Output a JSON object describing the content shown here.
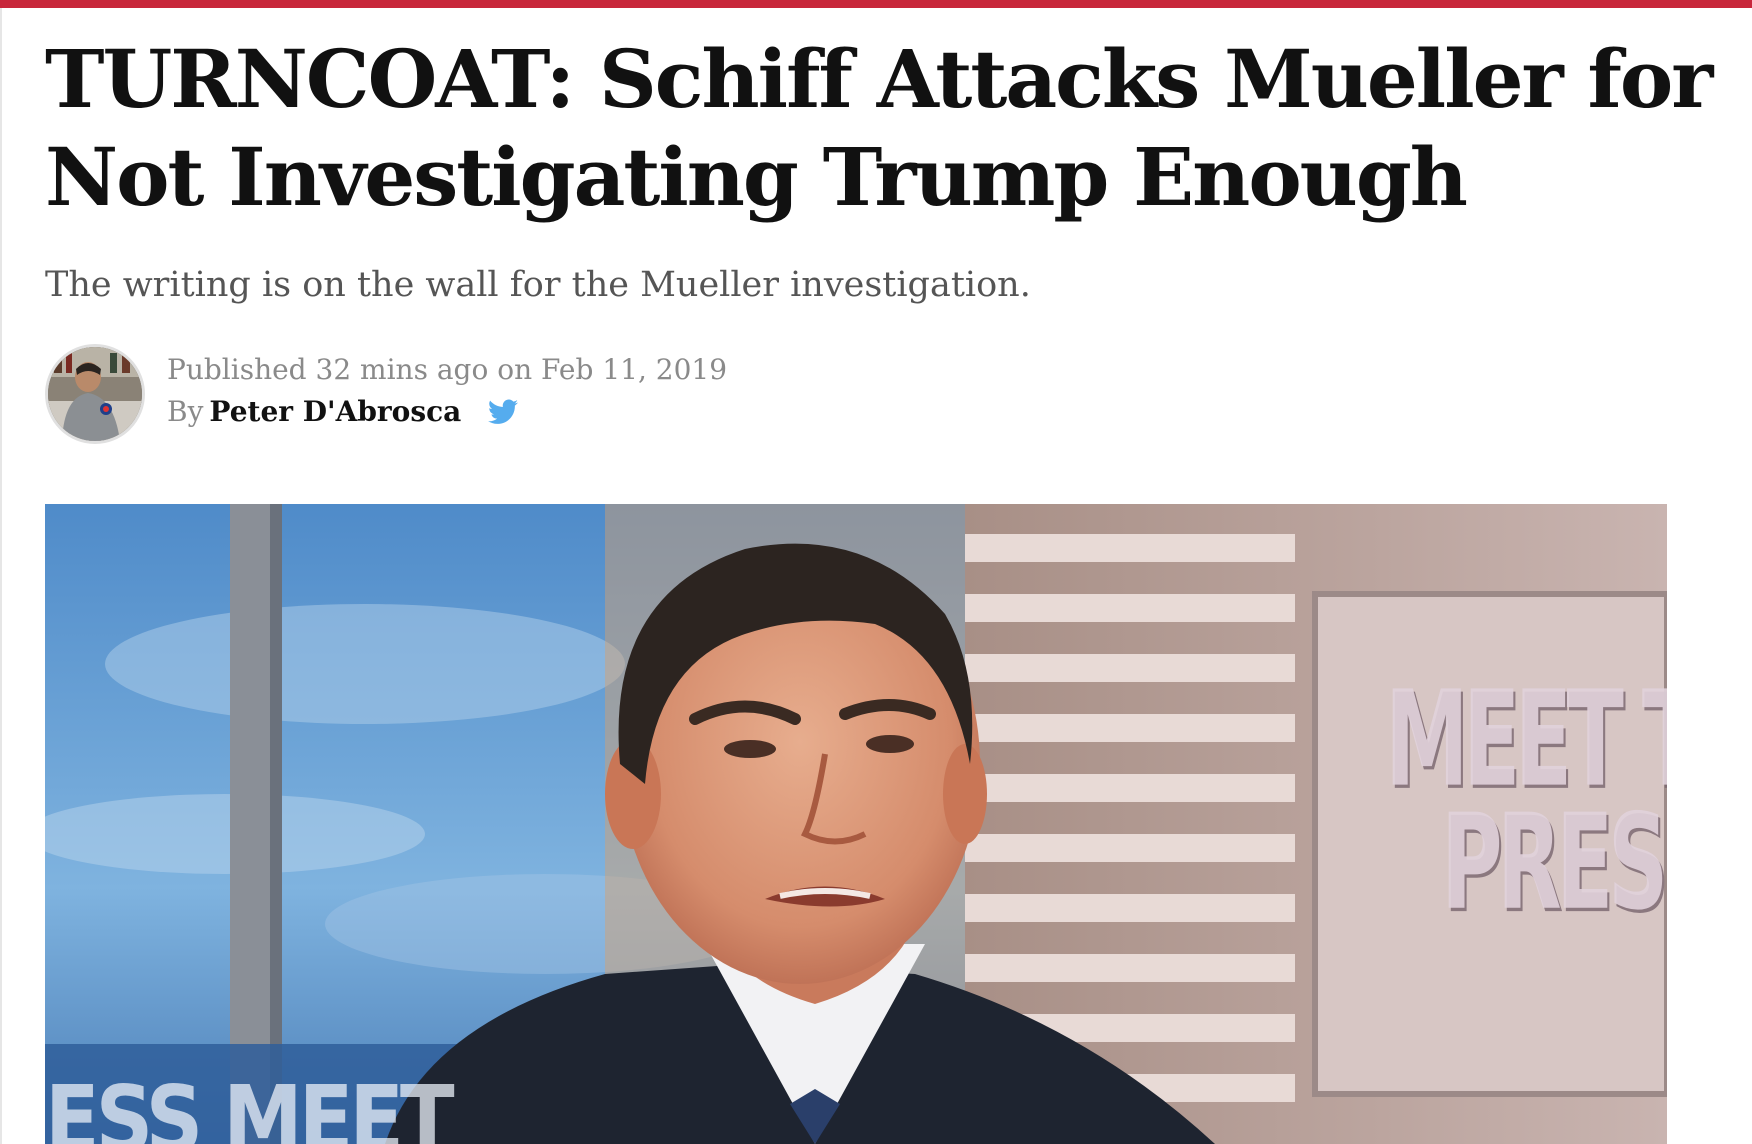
{
  "article": {
    "headline": "TURNCOAT: Schiff Attacks Mueller for Not Investigating Trump Enough",
    "subtitle": "The writing is on the wall for the Mueller investigation.",
    "published_prefix": "Published",
    "published_relative": "32 mins ago",
    "published_on": "on",
    "published_date": "Feb 11, 2019",
    "by_label": "By",
    "author": "Peter D'Abrosca"
  },
  "hero_image": {
    "corner_text": "ESS  MEET",
    "brand_line1": "MEET T",
    "brand_line2": "PRES"
  },
  "icons": {
    "twitter": "twitter-bird-icon",
    "avatar": "author-avatar"
  },
  "colors": {
    "accent_bar": "#c8273b",
    "twitter_blue": "#55acee",
    "headline": "#111111",
    "subtitle": "#555555",
    "meta": "#8a8a8a"
  }
}
